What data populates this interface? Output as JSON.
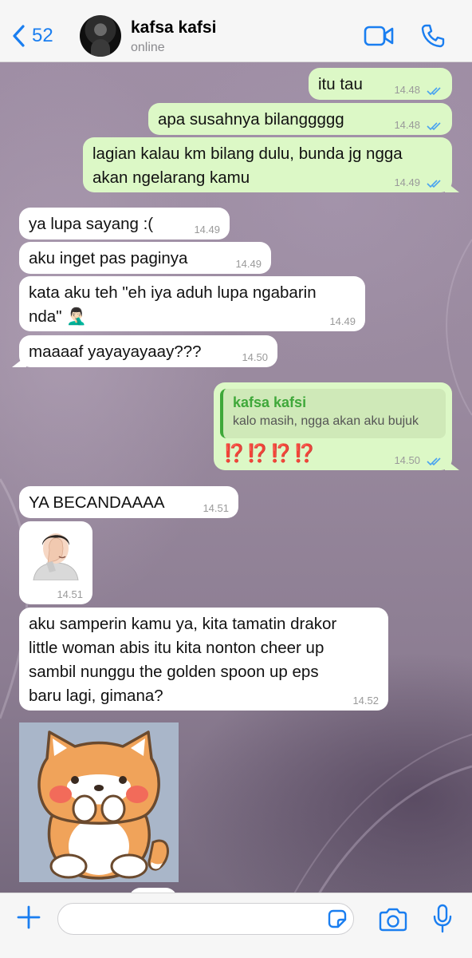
{
  "header": {
    "back_count": "52",
    "contact_name": "kafsa kafsi",
    "status": "online"
  },
  "messages": [
    {
      "dir": "out",
      "text": "itu tau",
      "time": "14.48",
      "ticks": "read"
    },
    {
      "dir": "out",
      "text": "apa susahnya bilanggggg",
      "time": "14.48",
      "ticks": "read"
    },
    {
      "dir": "out",
      "lines": [
        "lagian kalau km bilang dulu, bunda jg ngga",
        "akan ngelarang kamu"
      ],
      "time": "14.49",
      "ticks": "read"
    },
    {
      "dir": "in",
      "text": "ya lupa sayang :(",
      "time": "14.49"
    },
    {
      "dir": "in",
      "text": "aku inget pas paginya",
      "time": "14.49"
    },
    {
      "dir": "in",
      "lines": [
        "kata aku teh \"eh iya aduh lupa ngabarin",
        "nda\" 🤦🏻‍♂️"
      ],
      "time": "14.49"
    },
    {
      "dir": "in",
      "text": "maaaaf yayayayaay???",
      "time": "14.50"
    },
    {
      "dir": "out",
      "quote": {
        "author": "kafsa kafsi",
        "text": "kalo masih, ngga akan aku bujuk"
      },
      "text": "⁉️⁉️⁉️⁉️",
      "time": "14.50",
      "ticks": "read"
    },
    {
      "dir": "in",
      "text": "YA BECANDAAAA",
      "time": "14.51"
    },
    {
      "dir": "in",
      "emoji": "facepalm-emoji",
      "time": "14.51"
    },
    {
      "dir": "in",
      "lines": [
        "aku samperin kamu ya, kita tamatin drakor",
        "little woman abis itu kita nonton cheer up",
        "sambil nunggu the golden spoon up eps",
        "baru lagi, gimana?"
      ],
      "time": "14.52"
    },
    {
      "dir": "in",
      "sticker": "shiba-dog-sticker"
    }
  ],
  "composer": {
    "placeholder": ""
  },
  "colors": {
    "accent": "#1a7ef0",
    "outgoing_bubble": "#dcf8c6",
    "incoming_bubble": "#ffffff",
    "read_ticks": "#4aa3f0",
    "quote_author": "#3fa83a"
  }
}
